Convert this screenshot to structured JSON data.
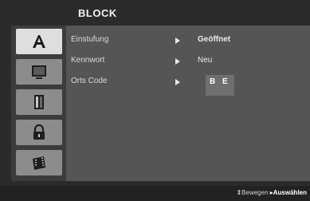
{
  "menu": {
    "title": "BLOCK"
  },
  "tabs": [
    {
      "icon": "a-letter-icon",
      "active": true
    },
    {
      "icon": "screen-icon",
      "active": false
    },
    {
      "icon": "speaker-icon",
      "active": false
    },
    {
      "icon": "lock-icon",
      "active": false
    },
    {
      "icon": "film-icon",
      "active": false
    }
  ],
  "settings": [
    {
      "label": "Einstufung",
      "value": "Geöffnet"
    },
    {
      "label": "Kennwort",
      "value": "Neu"
    },
    {
      "label": "Orts Code",
      "value": "B E"
    }
  ],
  "footer": {
    "move_glyph": "⇕",
    "move_label": "Bewegen",
    "select_glyph": "▸",
    "select_label": "Auswählen"
  },
  "colors": {
    "background": "#2b2b2b",
    "panel": "#4a4a4a",
    "tab_active": "#dedede",
    "tab_inactive": "#8c8c8c",
    "text": "#e8e8e8"
  }
}
